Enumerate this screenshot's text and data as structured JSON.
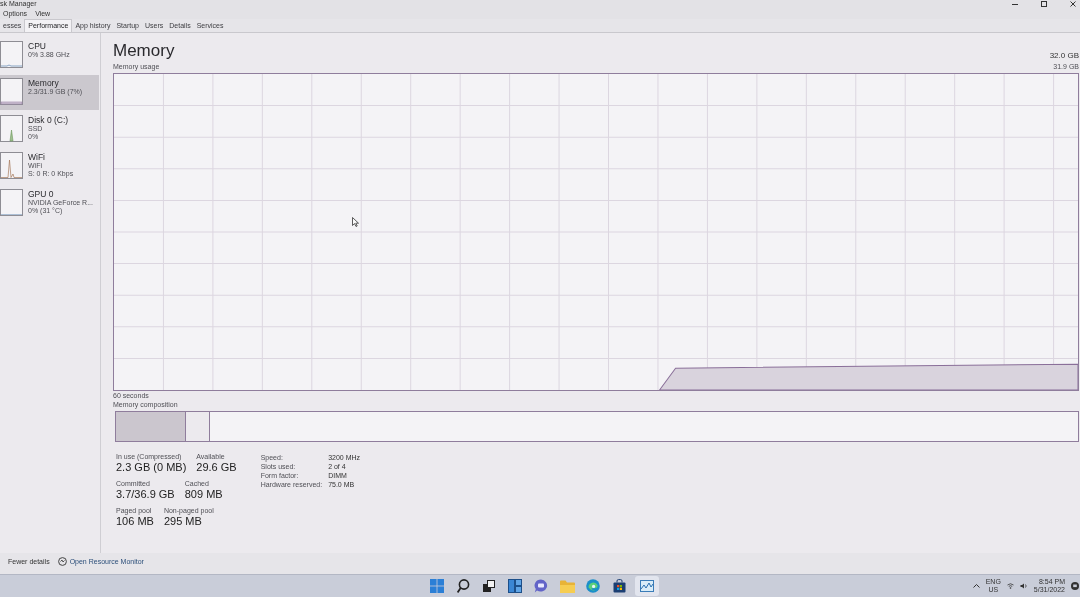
{
  "window": {
    "title": "sk Manager"
  },
  "menu": [
    "Options",
    "View"
  ],
  "tabs": [
    {
      "label": "esses",
      "selected": false
    },
    {
      "label": "Performance",
      "selected": true
    },
    {
      "label": "App history",
      "selected": false
    },
    {
      "label": "Startup",
      "selected": false
    },
    {
      "label": "Users",
      "selected": false
    },
    {
      "label": "Details",
      "selected": false
    },
    {
      "label": "Services",
      "selected": false
    }
  ],
  "sidebar": {
    "items": [
      {
        "kind": "cpu",
        "name": "CPU",
        "lines": [
          "0% 3.88 GHz"
        ],
        "selected": false
      },
      {
        "kind": "memory",
        "name": "Memory",
        "lines": [
          "2.3/31.9 GB (7%)"
        ],
        "selected": true
      },
      {
        "kind": "disk",
        "name": "Disk 0 (C:)",
        "lines": [
          "SSD",
          "0%"
        ],
        "selected": false
      },
      {
        "kind": "wifi",
        "name": "WiFi",
        "lines": [
          "WiFi",
          "S: 0 R: 0 Kbps"
        ],
        "selected": false
      },
      {
        "kind": "gpu",
        "name": "GPU 0",
        "lines": [
          "NVIDIA GeForce R...",
          "0% (31 °C)"
        ],
        "selected": false
      }
    ]
  },
  "main": {
    "title": "Memory",
    "total": "32.0 GB",
    "graph_label": "Memory usage",
    "graph_max": "31.9 GB",
    "time_span": "60 seconds",
    "composition_label": "Memory composition",
    "composition": [
      {
        "kind": "in-use",
        "level": 0.073
      },
      {
        "kind": "standby",
        "level": 0.025
      }
    ],
    "stat_rows": [
      [
        {
          "label": "In use (Compressed)",
          "value": "2.3 GB (0 MB)"
        },
        {
          "label": "Available",
          "value": "29.6 GB"
        }
      ],
      [
        {
          "label": "Committed",
          "value": "3.7/36.9 GB"
        },
        {
          "label": "Cached",
          "value": "809 MB"
        }
      ],
      [
        {
          "label": "Paged pool",
          "value": "106 MB"
        },
        {
          "label": "Non-paged pool",
          "value": "295 MB"
        }
      ]
    ],
    "details": [
      {
        "label": "Speed:",
        "value": "3200 MHz"
      },
      {
        "label": "Slots used:",
        "value": "2 of 4"
      },
      {
        "label": "Form factor:",
        "value": "DIMM"
      },
      {
        "label": "Hardware reserved:",
        "value": "75.0 MB"
      }
    ]
  },
  "footer": {
    "fewer_details": "Fewer details",
    "resource_monitor": "Open Resource Monitor"
  },
  "taskbar": {
    "apps": [
      {
        "kind": "start",
        "selected": false
      },
      {
        "kind": "search",
        "selected": false
      },
      {
        "kind": "task-view",
        "selected": false
      },
      {
        "kind": "widgets",
        "selected": false
      },
      {
        "kind": "chat",
        "selected": false
      },
      {
        "kind": "explorer",
        "selected": false
      },
      {
        "kind": "edge",
        "selected": false
      },
      {
        "kind": "store",
        "selected": false
      },
      {
        "kind": "task-manager",
        "selected": true
      }
    ],
    "language": [
      "ENG",
      "US"
    ],
    "time": "8:54 PM",
    "date": "5/31/2022"
  }
}
